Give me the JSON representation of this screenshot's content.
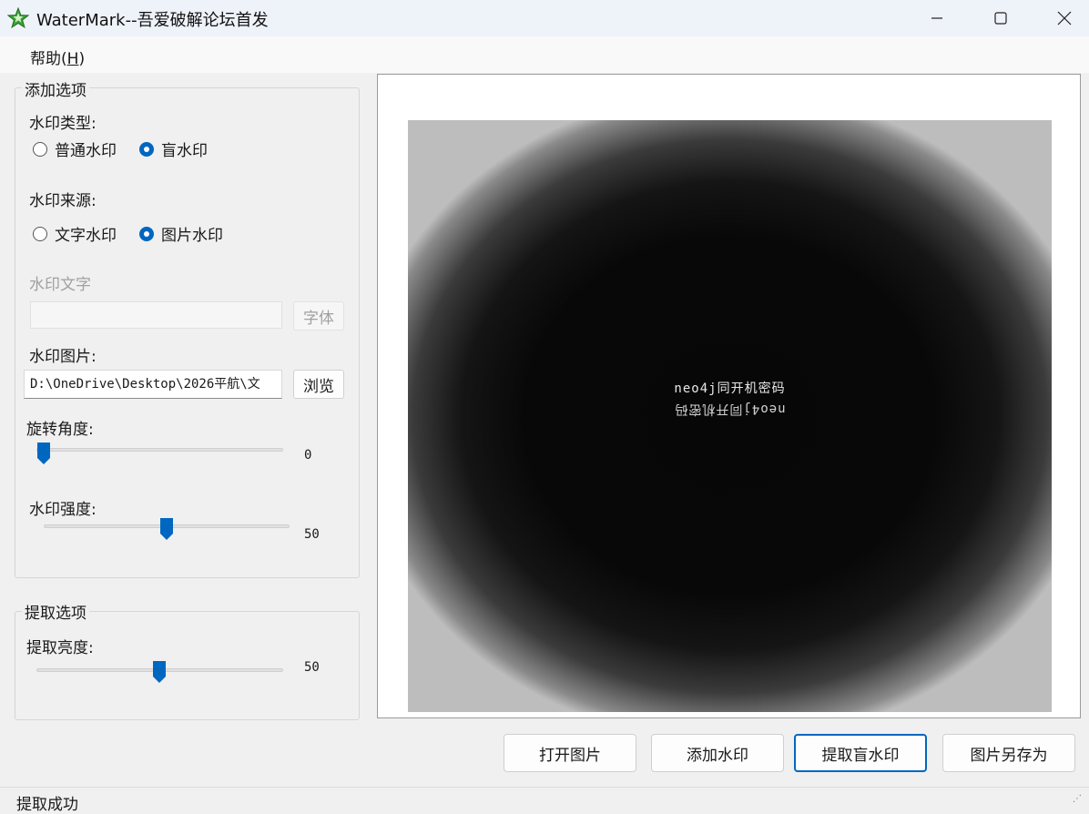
{
  "window": {
    "title": "WaterMark--吾爱破解论坛首发",
    "icon": "star-icon",
    "controls": [
      "minimize-icon",
      "maximize-icon",
      "close-icon"
    ]
  },
  "menu": {
    "help_text": "帮助(",
    "help_key": "H",
    "help_close": ")"
  },
  "add_options": {
    "group_title": "添加选项",
    "type_label": "水印类型:",
    "type_options": [
      {
        "label": "普通水印",
        "selected": false
      },
      {
        "label": "盲水印",
        "selected": true
      }
    ],
    "source_label": "水印来源:",
    "source_options": [
      {
        "label": "文字水印",
        "selected": false
      },
      {
        "label": "图片水印",
        "selected": true
      }
    ],
    "text_label": "水印文字",
    "text_value": "",
    "font_button": "字体",
    "image_label": "水印图片:",
    "image_path": "D:\\OneDrive\\Desktop\\2026平航\\文",
    "browse_button": "浏览",
    "rotation_label": "旋转角度:",
    "rotation_value": "0",
    "strength_label": "水印强度:",
    "strength_value": "50"
  },
  "extract_options": {
    "group_title": "提取选项",
    "brightness_label": "提取亮度:",
    "brightness_value": "50"
  },
  "preview": {
    "line1": "neo4j同开机密码",
    "line2": "neo4j同开机密码"
  },
  "buttons": {
    "open": "打开图片",
    "add": "添加水印",
    "extract": "提取盲水印",
    "save_as": "图片另存为"
  },
  "status": {
    "text": "提取成功"
  },
  "colors": {
    "accent": "#0067c0",
    "background": "#f0f0f0",
    "titlebar": "#eef2f9"
  }
}
